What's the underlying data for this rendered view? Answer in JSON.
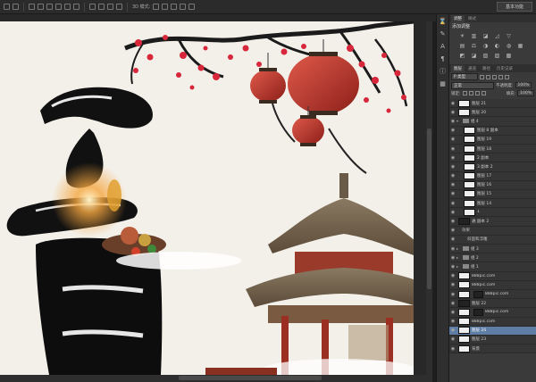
{
  "options_bar": {
    "mode_label": "3D 模式:",
    "workspace": "基本功能"
  },
  "right_strip_icons": [
    "history-icon",
    "brush-icon",
    "char-icon",
    "para-icon",
    "info-icon",
    "swatch-icon"
  ],
  "adjust_panel": {
    "tabs": [
      "调整",
      "样式"
    ],
    "title": "添加调整",
    "icons": [
      "☀",
      "▥",
      "◪",
      "◿",
      "▽",
      "",
      "▤",
      "⚖",
      "◑",
      "◐",
      "◍",
      "▦",
      "◩",
      "◪",
      "▧",
      "▨",
      "▩",
      ""
    ]
  },
  "layers_panel": {
    "tabs": [
      "图层",
      "通道",
      "路径",
      "历史记录"
    ],
    "filter_kind": "P 类型",
    "blend_mode": "正常",
    "opacity_label": "不透明度:",
    "opacity": "100%",
    "lock_label": "锁定:",
    "fill_label": "填充:",
    "fill": "100%",
    "layers": [
      {
        "name": "图层 21",
        "type": "layer",
        "thumb": "light",
        "indent": 0
      },
      {
        "name": "图层 20",
        "type": "layer",
        "thumb": "light",
        "indent": 0
      },
      {
        "name": "组 4",
        "type": "group",
        "open": true,
        "indent": 0
      },
      {
        "name": "图层 8 副本",
        "type": "layer",
        "thumb": "light",
        "indent": 1
      },
      {
        "name": "图层 19",
        "type": "layer",
        "thumb": "light",
        "indent": 1
      },
      {
        "name": "图层 18",
        "type": "layer",
        "thumb": "light",
        "indent": 1
      },
      {
        "name": "2 副本",
        "type": "layer",
        "thumb": "light",
        "indent": 1
      },
      {
        "name": "3 副本 2",
        "type": "layer",
        "thumb": "light",
        "indent": 1
      },
      {
        "name": "图层 17",
        "type": "layer",
        "thumb": "light",
        "indent": 1
      },
      {
        "name": "图层 16",
        "type": "layer",
        "thumb": "light",
        "indent": 1
      },
      {
        "name": "图层 15",
        "type": "layer",
        "thumb": "light",
        "indent": 1
      },
      {
        "name": "图层 14",
        "type": "layer",
        "thumb": "light",
        "indent": 1
      },
      {
        "name": "1",
        "type": "layer",
        "thumb": "light",
        "indent": 1
      },
      {
        "name": "通 副本 2",
        "type": "layer",
        "thumb": "dark",
        "indent": 0
      },
      {
        "name": "效果",
        "type": "fx",
        "indent": 1
      },
      {
        "name": "斜面和浮雕",
        "type": "fx",
        "indent": 2
      },
      {
        "name": "组 3",
        "type": "group",
        "open": false,
        "indent": 0
      },
      {
        "name": "组 2",
        "type": "group",
        "open": false,
        "indent": 0
      },
      {
        "name": "组 1",
        "type": "group",
        "open": false,
        "indent": 0
      },
      {
        "name": "888pic.com",
        "type": "layer",
        "thumb": "light",
        "indent": 0
      },
      {
        "name": "888pic.com",
        "type": "layer",
        "thumb": "light",
        "indent": 0
      },
      {
        "name": "888pic.com",
        "type": "layer",
        "thumb": "light",
        "mask": true,
        "indent": 0
      },
      {
        "name": "图层 22",
        "type": "layer",
        "thumb": "dark",
        "indent": 0
      },
      {
        "name": "888pic.com",
        "type": "layer",
        "thumb": "light",
        "mask": true,
        "indent": 0
      },
      {
        "name": "888pic.com",
        "type": "layer",
        "thumb": "light",
        "indent": 0
      },
      {
        "name": "图层 24",
        "type": "layer",
        "thumb": "light",
        "selected": true,
        "indent": 0
      },
      {
        "name": "图层 23",
        "type": "layer",
        "thumb": "light",
        "indent": 0
      },
      {
        "name": "背景",
        "type": "layer",
        "thumb": "light",
        "indent": 0
      }
    ]
  }
}
